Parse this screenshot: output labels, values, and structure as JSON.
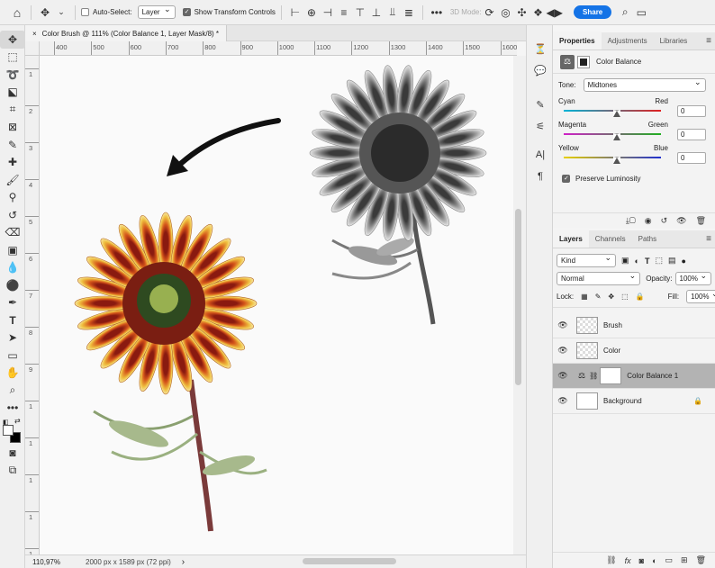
{
  "options_bar": {
    "auto_select_label": "Auto-Select:",
    "auto_select_value": "Layer",
    "show_transform_label": "Show Transform Controls",
    "mode_3d_label": "3D Mode:",
    "share_label": "Share"
  },
  "document": {
    "tab_title": "Color Brush @ 111% (Color Balance 1, Layer Mask/8) *",
    "close_glyph": "×",
    "ruler_h_labels": [
      "400",
      "500",
      "600",
      "700",
      "800",
      "900",
      "1000",
      "1100",
      "1200",
      "1300",
      "1400",
      "1500",
      "1600"
    ],
    "ruler_v_labels": [
      "1",
      "2",
      "3",
      "4",
      "5",
      "6",
      "7",
      "8",
      "9",
      "1",
      "1",
      "1",
      "1",
      "1"
    ],
    "zoom": "110,97%",
    "dimensions": "2000 px x 1589 px (72 ppi)",
    "status_arrow": "›"
  },
  "properties": {
    "tabs": [
      "Properties",
      "Adjustments",
      "Libraries"
    ],
    "adjustment_title": "Color Balance",
    "tone_label": "Tone:",
    "tone_value": "Midtones",
    "sliders": [
      {
        "left": "Cyan",
        "right": "Red",
        "value": "0",
        "left_color": "#00b4d8",
        "right_color": "#e02020"
      },
      {
        "left": "Magenta",
        "right": "Green",
        "value": "0",
        "left_color": "#d020c8",
        "right_color": "#20b020"
      },
      {
        "left": "Yellow",
        "right": "Blue",
        "value": "0",
        "left_color": "#e8d000",
        "right_color": "#2030d0"
      }
    ],
    "preserve_luminosity": "Preserve Luminosity"
  },
  "layers": {
    "tabs": [
      "Layers",
      "Channels",
      "Paths"
    ],
    "filter_kind": "Kind",
    "blend_mode": "Normal",
    "opacity_label": "Opacity:",
    "opacity_value": "100%",
    "lock_label": "Lock:",
    "fill_label": "Fill:",
    "fill_value": "100%",
    "items": [
      {
        "name": "Brush"
      },
      {
        "name": "Color"
      },
      {
        "name": "Color Balance 1"
      },
      {
        "name": "Background"
      }
    ]
  },
  "colors": {
    "accent": "#1473e6",
    "selected_layer": "#b3b3b3"
  }
}
